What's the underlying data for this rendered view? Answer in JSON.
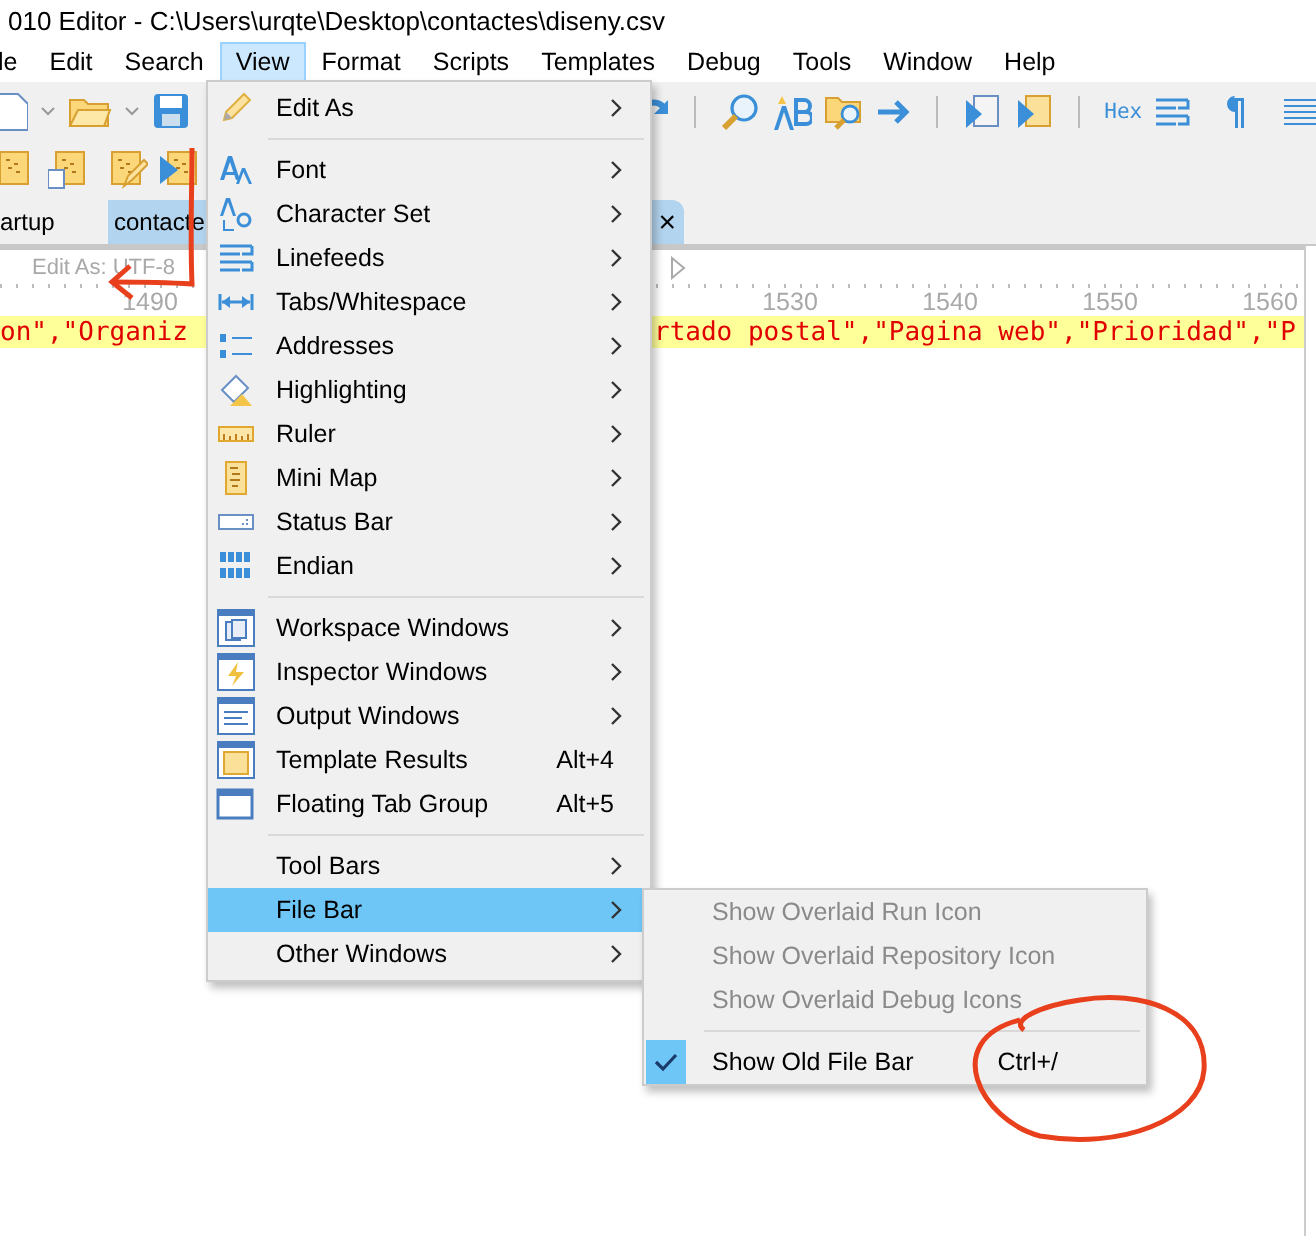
{
  "window": {
    "title": "010 Editor - C:\\Users\\urqte\\Desktop\\contactes\\diseny.csv"
  },
  "menu_bar": [
    {
      "label": "le",
      "selected": false
    },
    {
      "label": "Edit",
      "selected": false
    },
    {
      "label": "Search",
      "selected": false
    },
    {
      "label": "View",
      "selected": true
    },
    {
      "label": "Format",
      "selected": false
    },
    {
      "label": "Scripts",
      "selected": false
    },
    {
      "label": "Templates",
      "selected": false
    },
    {
      "label": "Debug",
      "selected": false
    },
    {
      "label": "Tools",
      "selected": false
    },
    {
      "label": "Window",
      "selected": false
    },
    {
      "label": "Help",
      "selected": false
    }
  ],
  "toolbar": {
    "hex_label": "Hex"
  },
  "file_tabs": [
    {
      "label": "artup",
      "selected": false
    },
    {
      "label": "contacte",
      "selected": true,
      "close": "×"
    }
  ],
  "editor": {
    "edit_as": "Edit As: UTF-8",
    "ruler_labels": [
      "1490",
      "1530",
      "1540",
      "1550",
      "1560"
    ],
    "line_fragments": [
      "on\",\"Organiz",
      "rtado postal\",\"Pagina web\",\"Prioridad\",\"P"
    ]
  },
  "view_menu": [
    {
      "kind": "item",
      "label": "Edit As",
      "has_submenu": true,
      "selected": false
    },
    {
      "kind": "separator"
    },
    {
      "kind": "item",
      "label": "Font",
      "has_submenu": true,
      "selected": false
    },
    {
      "kind": "item",
      "label": "Character Set",
      "has_submenu": true,
      "selected": false
    },
    {
      "kind": "item",
      "label": "Linefeeds",
      "has_submenu": true,
      "selected": false
    },
    {
      "kind": "item",
      "label": "Tabs/Whitespace",
      "has_submenu": true,
      "selected": false
    },
    {
      "kind": "item",
      "label": "Addresses",
      "has_submenu": true,
      "selected": false
    },
    {
      "kind": "item",
      "label": "Highlighting",
      "has_submenu": true,
      "selected": false
    },
    {
      "kind": "item",
      "label": "Ruler",
      "has_submenu": true,
      "selected": false
    },
    {
      "kind": "item",
      "label": "Mini Map",
      "has_submenu": true,
      "selected": false
    },
    {
      "kind": "item",
      "label": "Status Bar",
      "has_submenu": true,
      "selected": false
    },
    {
      "kind": "item",
      "label": "Endian",
      "has_submenu": true,
      "selected": false
    },
    {
      "kind": "separator"
    },
    {
      "kind": "item",
      "label": "Workspace Windows",
      "has_submenu": true,
      "selected": false
    },
    {
      "kind": "item",
      "label": "Inspector Windows",
      "has_submenu": true,
      "selected": false
    },
    {
      "kind": "item",
      "label": "Output Windows",
      "has_submenu": true,
      "selected": false
    },
    {
      "kind": "item",
      "label": "Template Results",
      "shortcut": "Alt+4",
      "has_submenu": false,
      "selected": false
    },
    {
      "kind": "item",
      "label": "Floating Tab Group",
      "shortcut": "Alt+5",
      "has_submenu": false,
      "selected": false
    },
    {
      "kind": "separator"
    },
    {
      "kind": "item",
      "label": "Tool Bars",
      "has_submenu": true,
      "selected": false
    },
    {
      "kind": "item",
      "label": "File Bar",
      "has_submenu": true,
      "selected": true
    },
    {
      "kind": "item",
      "label": "Other Windows",
      "has_submenu": true,
      "selected": false
    }
  ],
  "file_bar_submenu": [
    {
      "kind": "item",
      "label": "Show Overlaid Run Icon",
      "disabled": true,
      "checked": false
    },
    {
      "kind": "item",
      "label": "Show Overlaid Repository Icon",
      "disabled": true,
      "checked": false
    },
    {
      "kind": "item",
      "label": "Show Overlaid Debug Icons",
      "disabled": true,
      "checked": false
    },
    {
      "kind": "separator"
    },
    {
      "kind": "item",
      "label": "Show Old File Bar",
      "shortcut": "Ctrl+/",
      "disabled": false,
      "checked": true
    }
  ]
}
